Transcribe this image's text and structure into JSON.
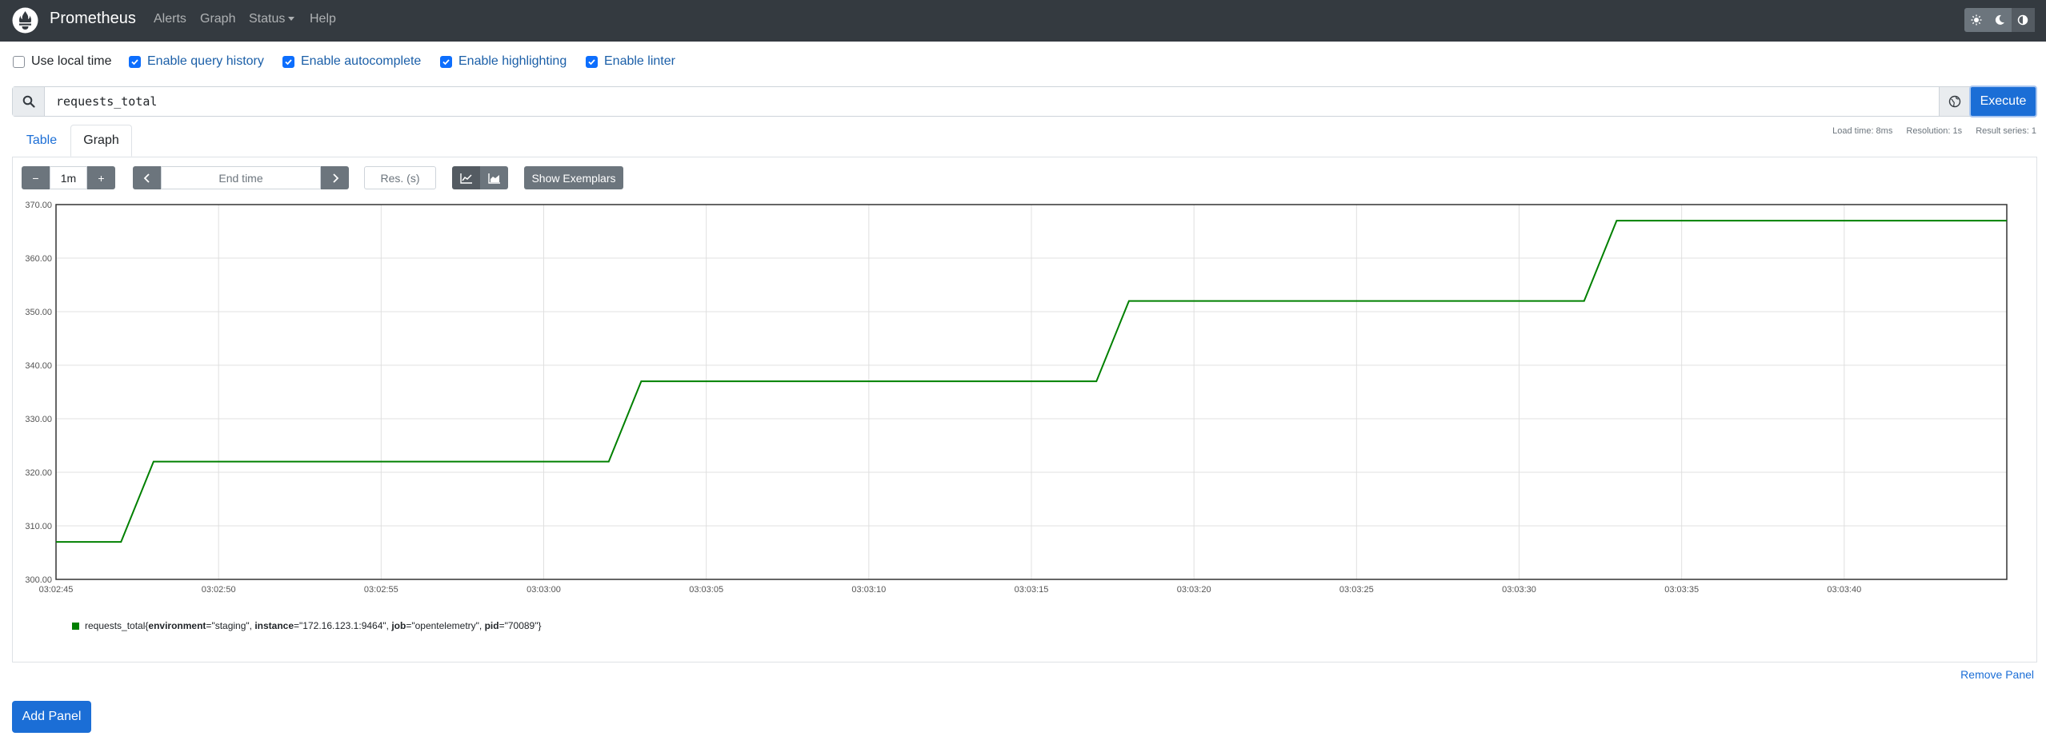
{
  "navbar": {
    "brand": "Prometheus",
    "links": [
      "Alerts",
      "Graph",
      "Status",
      "Help"
    ]
  },
  "options": [
    {
      "label": "Use local time",
      "checked": false
    },
    {
      "label": "Enable query history",
      "checked": true
    },
    {
      "label": "Enable autocomplete",
      "checked": true
    },
    {
      "label": "Enable highlighting",
      "checked": true
    },
    {
      "label": "Enable linter",
      "checked": true
    }
  ],
  "query": {
    "expression": "requests_total",
    "execute_label": "Execute"
  },
  "tabs": [
    "Table",
    "Graph"
  ],
  "active_tab": "Graph",
  "stats": {
    "load_time": "Load time: 8ms",
    "resolution": "Resolution: 1s",
    "result_series": "Result series: 1"
  },
  "controls": {
    "minus": "−",
    "range": "1m",
    "plus": "+",
    "end_time_placeholder": "End time",
    "resolution_placeholder": "Res. (s)",
    "exemplars_label": "Show Exemplars"
  },
  "chart_data": {
    "type": "line",
    "y_ticks": [
      "300.00",
      "310.00",
      "320.00",
      "330.00",
      "340.00",
      "350.00",
      "360.00",
      "370.00"
    ],
    "ylim": [
      300,
      370
    ],
    "x_ticks": [
      "03:02:45",
      "03:02:50",
      "03:02:55",
      "03:03:00",
      "03:03:05",
      "03:03:10",
      "03:03:15",
      "03:03:20",
      "03:03:25",
      "03:03:30",
      "03:03:35",
      "03:03:40"
    ],
    "xlim_seconds": [
      0,
      60
    ],
    "grid": true,
    "color": "#008000",
    "series": [
      {
        "points_seconds": [
          [
            0,
            307
          ],
          [
            2,
            307
          ],
          [
            3,
            322
          ],
          [
            17,
            322
          ],
          [
            18,
            337
          ],
          [
            32,
            337
          ],
          [
            33,
            352
          ],
          [
            47,
            352
          ],
          [
            48,
            367
          ],
          [
            60,
            367
          ]
        ]
      }
    ]
  },
  "legend": {
    "metric": "requests_total",
    "labels": [
      {
        "key": "environment",
        "value": "\"staging\""
      },
      {
        "key": "instance",
        "value": "\"172.16.123.1:9464\""
      },
      {
        "key": "job",
        "value": "\"opentelemetry\""
      },
      {
        "key": "pid",
        "value": "\"70089\""
      }
    ]
  },
  "remove_panel": "Remove Panel",
  "add_panel": "Add Panel"
}
